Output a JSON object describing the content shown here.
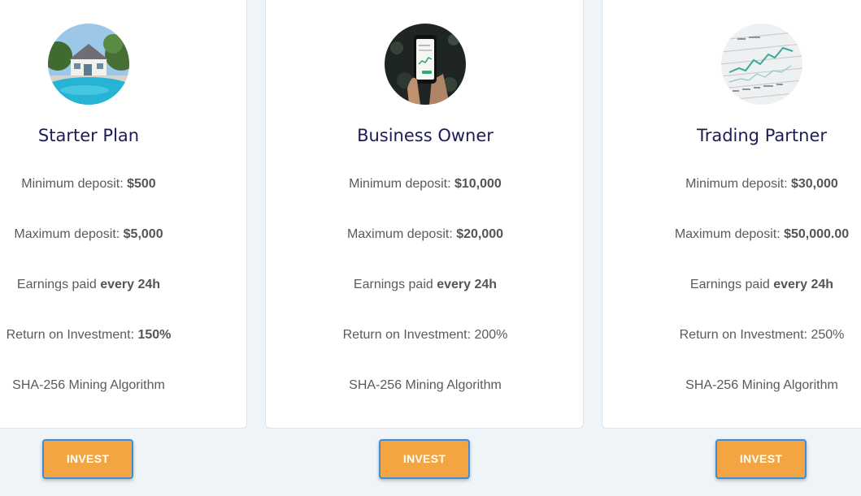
{
  "colors": {
    "background": "#eef4f8",
    "card": "#ffffff",
    "title": "#1d1b5a",
    "text": "#5a5a5a",
    "button": "#f2a541",
    "button_border": "#3b8fd8"
  },
  "plans": [
    {
      "image_icon": "house-pool-photo",
      "title": "Starter Plan",
      "min_label": "Minimum deposit: ",
      "min_value": "$500",
      "max_label": "Maximum deposit: ",
      "max_value": "$5,000",
      "earn_label": "Earnings paid ",
      "earn_value": "every 24h",
      "roi_label": "Return on Investment: ",
      "roi_value": "150%",
      "algorithm": "SHA-256 Mining Algorithm",
      "button": "INVEST"
    },
    {
      "image_icon": "phone-in-hand-photo",
      "title": "Business Owner",
      "min_label": "Minimum deposit: ",
      "min_value": "$10,000",
      "max_label": "Maximum deposit: ",
      "max_value": "$20,000",
      "earn_label": "Earnings paid ",
      "earn_value": "every 24h",
      "roi_label": "Return on Investment: ",
      "roi_value": "200%",
      "algorithm": "SHA-256 Mining Algorithm",
      "button": "INVEST"
    },
    {
      "image_icon": "stock-chart-photo",
      "title": "Trading Partner",
      "min_label": "Minimum deposit: ",
      "min_value": "$30,000",
      "max_label": "Maximum deposit: ",
      "max_value": "$50,000.00",
      "earn_label": "Earnings paid ",
      "earn_value": "every 24h",
      "roi_label": "Return on Investment: ",
      "roi_value": "250%",
      "algorithm": "SHA-256 Mining Algorithm",
      "button": "INVEST"
    }
  ]
}
